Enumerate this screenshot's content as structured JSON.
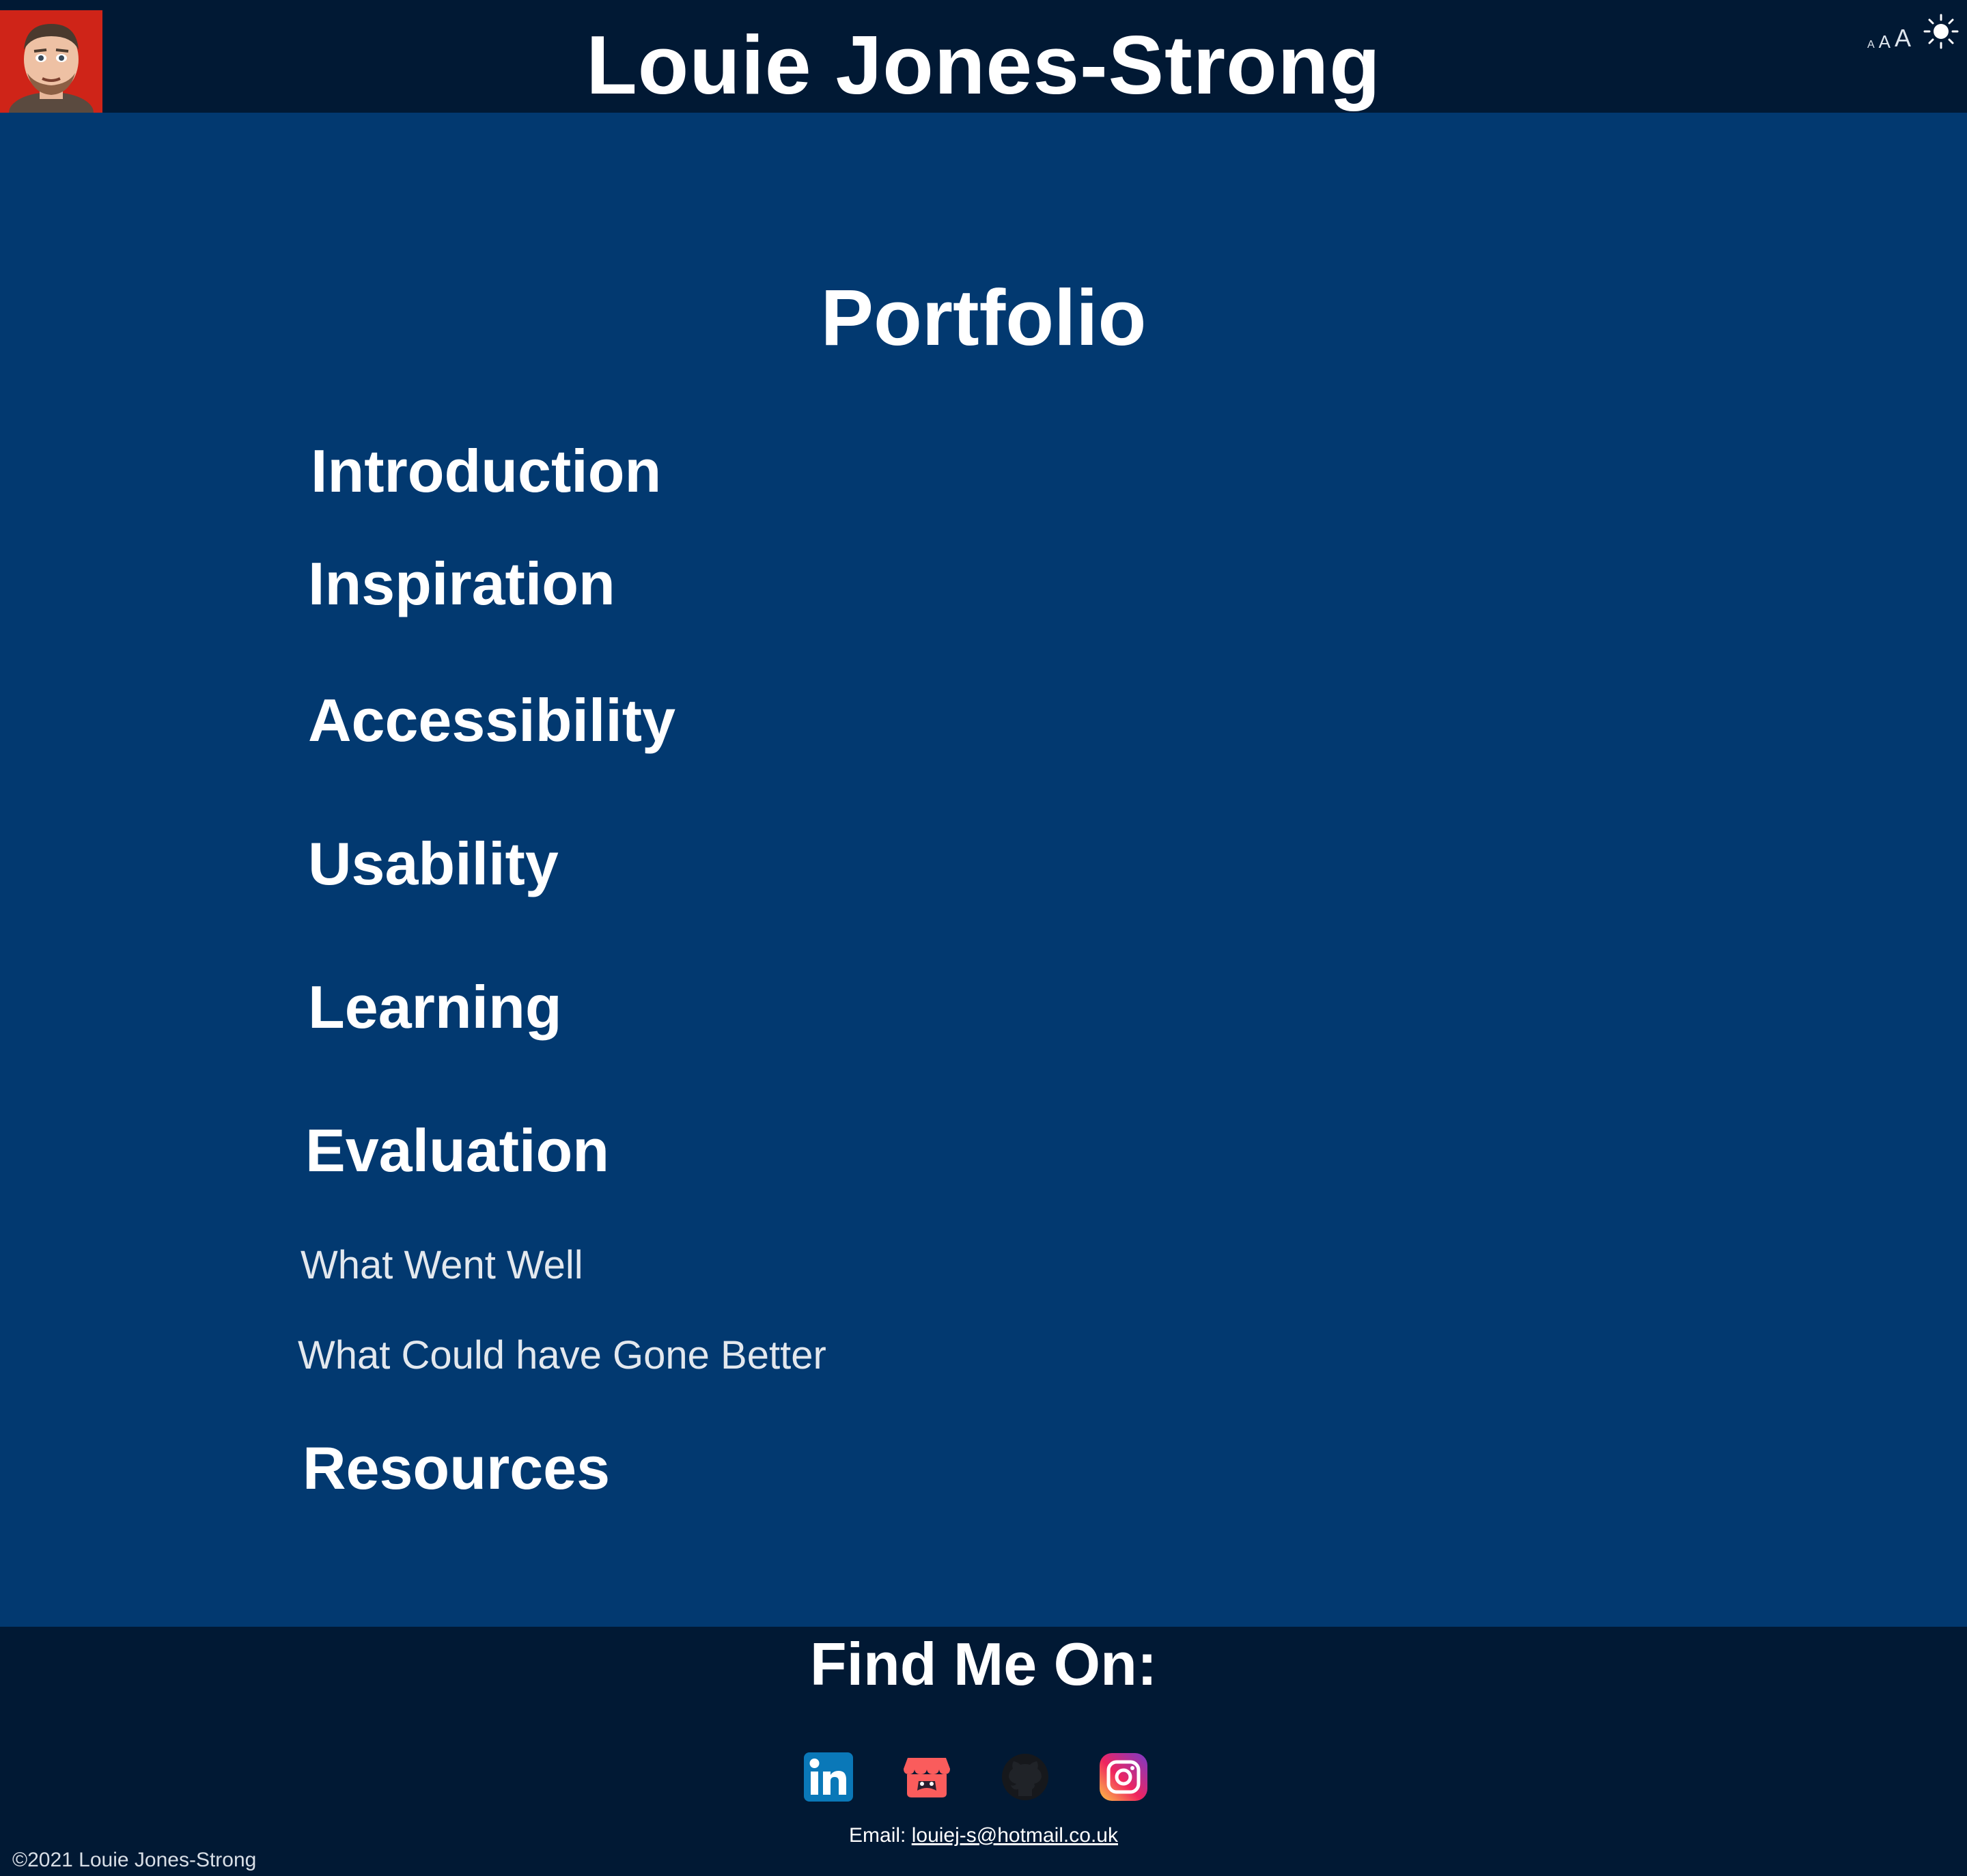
{
  "header": {
    "site_title": "Louie Jones-Strong",
    "font_sizes": [
      "A",
      "A",
      "A"
    ],
    "theme_icon": "sun-icon",
    "avatar_icon": "avatar"
  },
  "main": {
    "page_title": "Portfolio",
    "toc": {
      "introduction": "Introduction",
      "inspiration": "Inspiration",
      "accessibility": "Accessibility",
      "usability": "Usability",
      "learning": "Learning",
      "evaluation": "Evaluation",
      "what_went_well": "What Went Well",
      "what_could_be_better": "What Could have Gone Better",
      "resources": "Resources"
    }
  },
  "footer": {
    "title": "Find Me On:",
    "socials": [
      "linkedin-icon",
      "itchio-icon",
      "github-icon",
      "instagram-icon"
    ],
    "email_label": "Email:",
    "email": "louiej-s@hotmail.co.uk",
    "copyright": "©2021 Louie Jones-Strong"
  },
  "colors": {
    "page_background": "#023970",
    "header_footer_background": "#011934",
    "text": "#ffffff"
  }
}
